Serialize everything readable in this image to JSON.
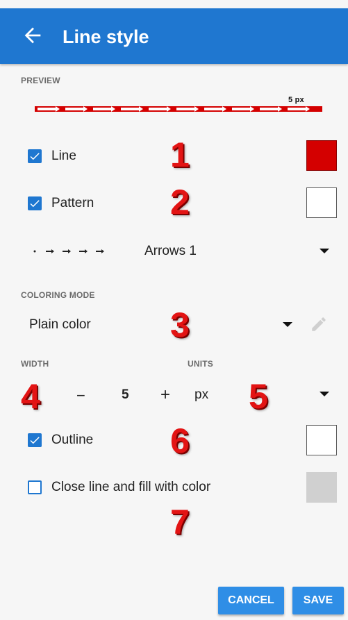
{
  "appbar": {
    "title": "Line style",
    "back_icon": "arrow-left-icon",
    "color": "#1f77d0"
  },
  "preview": {
    "label": "PREVIEW",
    "width_label": "5 px"
  },
  "line_row": {
    "label": "Line",
    "checked": true,
    "swatch_color": "#d40000",
    "marker": "1"
  },
  "pattern_row": {
    "label": "Pattern",
    "checked": true,
    "swatch_color": "#ffffff",
    "marker": "2"
  },
  "pattern_select": {
    "value": "Arrows 1"
  },
  "coloring": {
    "label": "COLORING MODE",
    "value": "Plain color",
    "marker": "3",
    "edit_icon": "pencil-icon"
  },
  "width": {
    "label": "WIDTH",
    "minus": "−",
    "value": "5",
    "plus": "+",
    "marker": "4"
  },
  "units": {
    "label": "UNITS",
    "value": "px",
    "marker": "5"
  },
  "outline_row": {
    "label": "Outline",
    "checked": true,
    "swatch_color": "#ffffff",
    "marker": "6"
  },
  "close_row": {
    "label": "Close line and fill with color",
    "checked": false,
    "swatch_color": "#d0d0d0",
    "marker": "7"
  },
  "buttons": {
    "cancel": "CANCEL",
    "save": "SAVE"
  }
}
